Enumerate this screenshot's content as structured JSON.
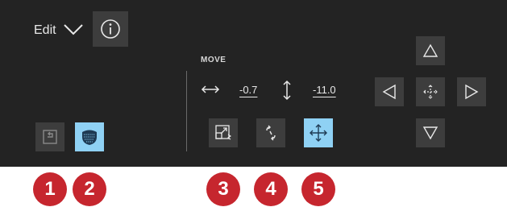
{
  "toolbar": {
    "edit_label": "Edit"
  },
  "move": {
    "title": "MOVE",
    "x_value": "-0.7",
    "y_value": "-11.0"
  },
  "callouts": {
    "c1": "1",
    "c2": "2",
    "c3": "3",
    "c4": "4",
    "c5": "5"
  },
  "colors": {
    "panel": "#232323",
    "button": "#3d3d3d",
    "active": "#8fd1f4",
    "callout": "#c6262e"
  },
  "icons": [
    "chevron-down-icon",
    "info-icon",
    "undo-icon",
    "stitch-fill-icon",
    "resize-icon",
    "rotate-icon",
    "move-icon",
    "horizontal-arrows-icon",
    "vertical-arrows-icon",
    "arrow-up-icon",
    "arrow-left-icon",
    "center-icon",
    "arrow-right-icon",
    "arrow-down-icon"
  ]
}
